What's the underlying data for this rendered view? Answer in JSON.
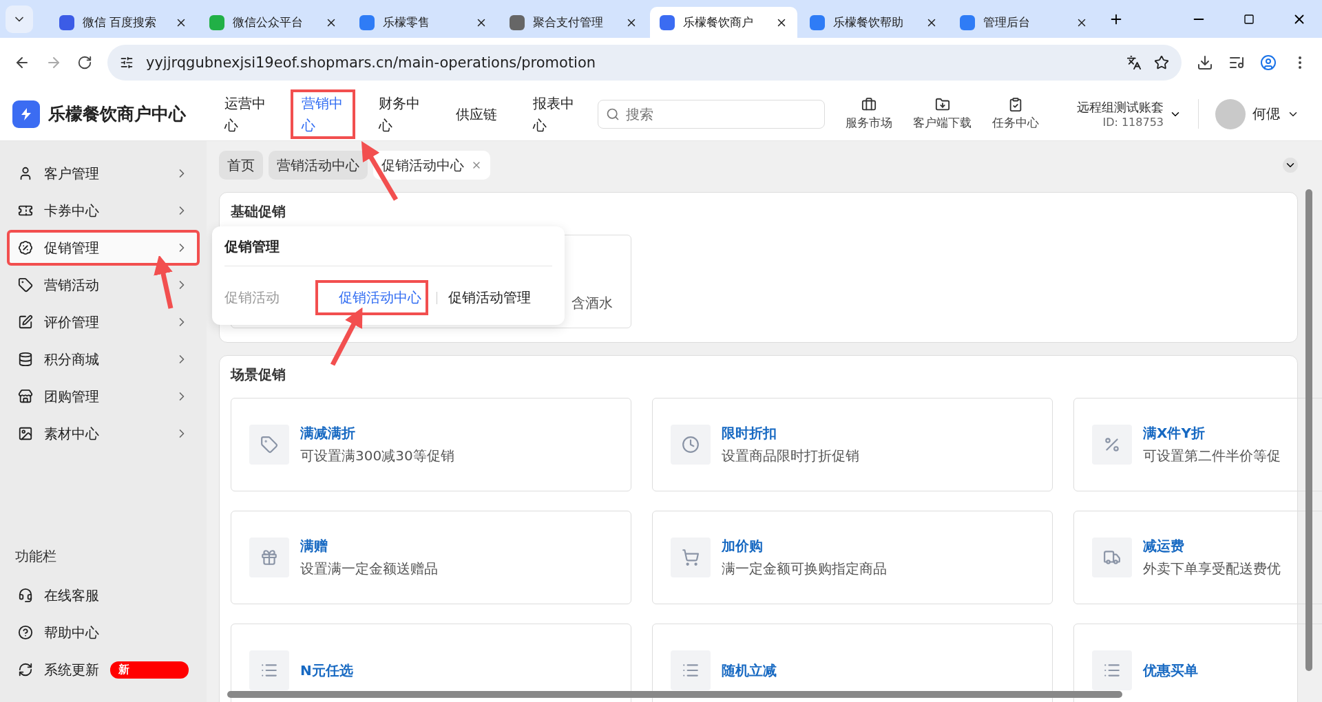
{
  "browser": {
    "tabs": [
      {
        "title": "微信 百度搜索",
        "selected": false
      },
      {
        "title": "微信公众平台",
        "selected": false
      },
      {
        "title": "乐檬零售",
        "selected": false
      },
      {
        "title": "聚合支付管理",
        "selected": false
      },
      {
        "title": "乐檬餐饮商户",
        "selected": true
      },
      {
        "title": "乐檬餐饮帮助",
        "selected": false
      },
      {
        "title": "管理后台",
        "selected": false
      }
    ],
    "address": "yyjjrqgubnexjsi19eof.shopmars.cn/main-operations/promotion"
  },
  "header": {
    "brand": "乐檬餐饮商户中心",
    "nav": [
      {
        "label": "运营中心",
        "selected": false,
        "annotated": false
      },
      {
        "label": "营销中心",
        "selected": true,
        "annotated": true
      },
      {
        "label": "财务中心",
        "selected": false,
        "annotated": false
      },
      {
        "label": "供应链",
        "selected": false,
        "annotated": false
      },
      {
        "label": "报表中心",
        "selected": false,
        "annotated": false
      }
    ],
    "search": {
      "placeholder": "搜索"
    },
    "tools": [
      {
        "kind": "market",
        "label": "服务市场"
      },
      {
        "kind": "download",
        "label": "客户端下载"
      },
      {
        "kind": "task",
        "label": "任务中心"
      }
    ],
    "account": {
      "name": "远程组测试账套",
      "id": "ID: 118753"
    },
    "user": "何偲"
  },
  "sidebar": {
    "items": [
      {
        "kind": "user",
        "label": "客户管理",
        "selected": false,
        "annotated": false
      },
      {
        "kind": "ticket",
        "label": "卡券中心",
        "selected": false,
        "annotated": false
      },
      {
        "kind": "badge",
        "label": "促销管理",
        "selected": true,
        "annotated": true
      },
      {
        "kind": "tag",
        "label": "营销活动",
        "selected": false,
        "annotated": false
      },
      {
        "kind": "edit",
        "label": "评价管理",
        "selected": false,
        "annotated": false
      },
      {
        "kind": "coins",
        "label": "积分商城",
        "selected": false,
        "annotated": false
      },
      {
        "kind": "store",
        "label": "团购管理",
        "selected": false,
        "annotated": false
      },
      {
        "kind": "image",
        "label": "素材中心",
        "selected": false,
        "annotated": false
      }
    ],
    "footer_title": "功能栏",
    "tools": [
      {
        "kind": "service",
        "label": "在线客服"
      },
      {
        "kind": "help",
        "label": "帮助中心"
      },
      {
        "kind": "update",
        "label": "系统更新",
        "badge": "新"
      }
    ]
  },
  "breadcrumbs": [
    {
      "label": "首页",
      "selected": false,
      "closable": false
    },
    {
      "label": "营销活动中心",
      "selected": false,
      "closable": false
    },
    {
      "label": "促销活动中心",
      "selected": true,
      "closable": true
    }
  ],
  "popup": {
    "title": "促销管理",
    "group": "促销活动",
    "links": [
      {
        "label": "促销活动中心",
        "selected": true,
        "annotated": true
      },
      {
        "label": "促销活动管理",
        "selected": false,
        "annotated": false
      }
    ]
  },
  "sections": [
    {
      "title": "基础促销",
      "items": [
        {
          "kind": "hidden",
          "desc": "含酒水"
        }
      ]
    },
    {
      "title": "场景促销",
      "items": [
        {
          "kind": "tag",
          "title": "满减满折",
          "desc": "可设置满300减30等促销"
        },
        {
          "kind": "clock",
          "title": "限时折扣",
          "desc": "设置商品限时打折促销"
        },
        {
          "kind": "percent",
          "title": "满X件Y折",
          "desc": "可设置第二件半价等促"
        },
        {
          "kind": "gift",
          "title": "满赠",
          "desc": "设置满一定金额送赠品"
        },
        {
          "kind": "cart",
          "title": "加价购",
          "desc": "满一定金额可换购指定商品"
        },
        {
          "kind": "truck",
          "title": "减运费",
          "desc": "外卖下单享受配送费优"
        },
        {
          "kind": "list",
          "title": "N元任选"
        },
        {
          "kind": "list",
          "title": "随机立减"
        },
        {
          "kind": "list",
          "title": "优惠买单"
        }
      ]
    }
  ]
}
